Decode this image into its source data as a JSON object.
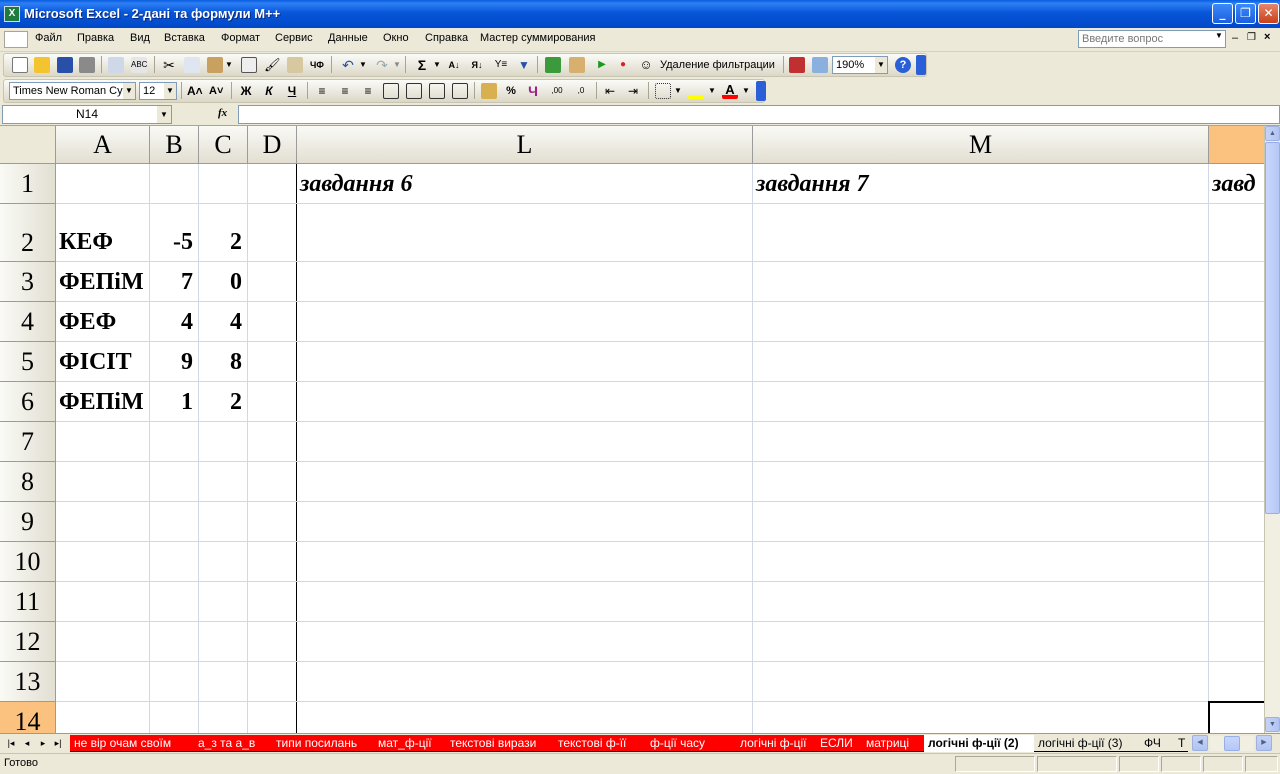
{
  "window": {
    "title": "Microsoft Excel - 2-дані та формули М++",
    "icon": "excel-app-icon",
    "controls": [
      "minimize-icon",
      "restore-icon",
      "close-icon"
    ]
  },
  "menubar": {
    "items": [
      "Файл",
      "Правка",
      "Вид",
      "Вставка",
      "Формат",
      "Сервис",
      "Данные",
      "Окно",
      "Справка",
      "Мастер суммирования"
    ],
    "help_placeholder": "Введите вопрос"
  },
  "toolbar_standard": {
    "filter_label": "Удаление фильтрации",
    "zoom": "190%"
  },
  "toolbar_format": {
    "font": "Times New Roman Cyr",
    "size": "12",
    "bold_label": "Ж",
    "italic_label": "К",
    "underline_label": "Ч",
    "percent_label": "%",
    "ch_label": "Ч"
  },
  "formula_bar": {
    "name_box": "N14",
    "fx_label": "fx",
    "value": ""
  },
  "sheet": {
    "columns": [
      "A",
      "B",
      "C",
      "D",
      "L",
      "M"
    ],
    "rows": [
      "1",
      "2",
      "3",
      "4",
      "5",
      "6",
      "7",
      "8",
      "9",
      "10",
      "11",
      "12",
      "13",
      "14"
    ],
    "cells": {
      "A2": "КЕФ",
      "B2": "-5",
      "C2": "2",
      "A3": "ФЕПіМ",
      "B3": "7",
      "C3": "0",
      "A4": "ФЕФ",
      "B4": "4",
      "C4": "4",
      "A5": "ФІСІТ",
      "B5": "9",
      "C5": "8",
      "A6": "ФЕПіМ",
      "B6": "1",
      "C6": "2",
      "L1": "завдання 6",
      "M1": "завдання 7",
      "N1": "завд"
    },
    "selected_cell": "N14"
  },
  "sheet_tabs": [
    "не вір очам своїм",
    "а_з та а_в",
    "типи посилань",
    "мат_ф-ції",
    "текстові вирази",
    "текстові ф-її",
    "ф-ції часу",
    "логічні ф-ції",
    "ЕСЛИ",
    "матриці",
    "логічні ф-ції (2)",
    "логічні ф-ції (3)",
    "ФЧ",
    "Т"
  ],
  "active_tab": "логічні ф-ції (2)",
  "tab_colors": {
    "red": "#ff0000",
    "active": "#ffffff"
  },
  "status": "Готово",
  "colors": {
    "titlebar": "#0856d8",
    "selected_header": "#fbc27f",
    "gridline": "#d0d7e5"
  }
}
